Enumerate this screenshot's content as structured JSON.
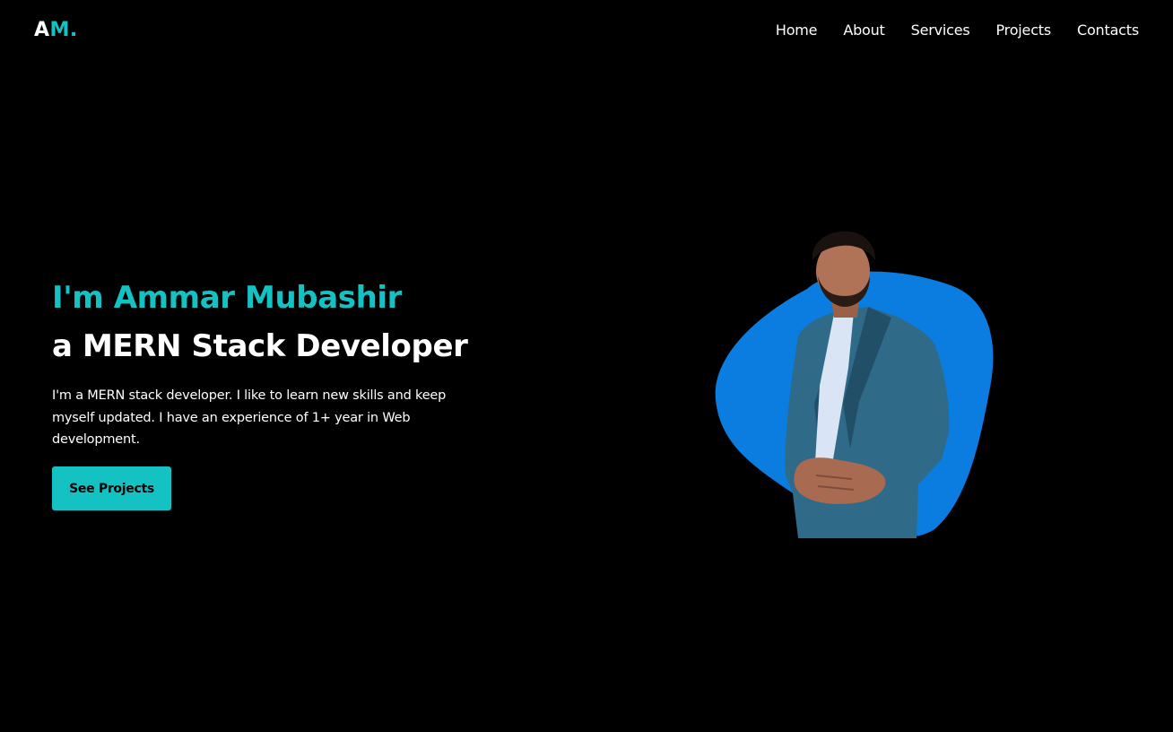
{
  "header": {
    "logo_primary": "A",
    "logo_accent": "M.",
    "nav": [
      "Home",
      "About",
      "Services",
      "Projects",
      "Contacts"
    ]
  },
  "hero": {
    "greeting": "I'm Ammar Mubashir",
    "role": "a MERN Stack Developer",
    "description": "I'm a MERN stack developer. I like to learn new skills and keep myself updated. I have an experience of 1+ year in Web development.",
    "cta_label": "See Projects"
  },
  "colors": {
    "background": "#000000",
    "accent": "#14c2c4",
    "blob": "#0b7de0",
    "text": "#ffffff"
  },
  "icons": {
    "portrait": "profile-photo"
  }
}
